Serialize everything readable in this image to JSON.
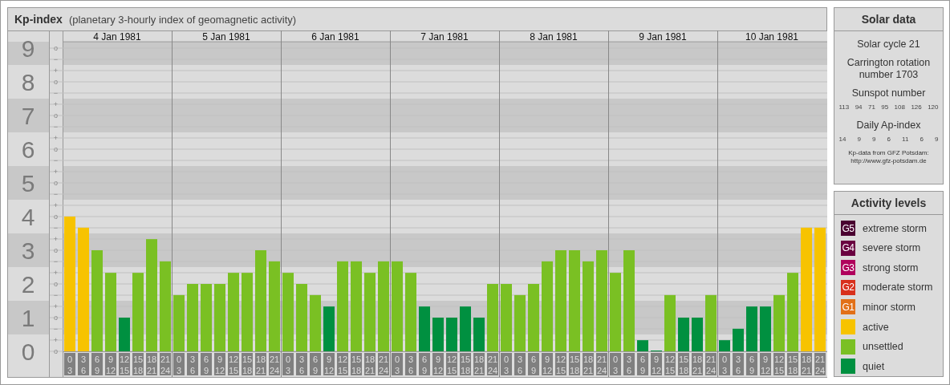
{
  "header": {
    "title": "Kp-index",
    "subtitle": "(planetary 3-hourly index of geomagnetic activity)"
  },
  "kp_chart": {
    "days": [
      "4 Jan 1981",
      "5 Jan 1981",
      "6 Jan 1981",
      "7 Jan 1981",
      "8 Jan 1981",
      "9 Jan 1981",
      "10 Jan 1981"
    ],
    "minor_ticks": [
      "o",
      "−",
      "+",
      "o",
      "−",
      "+",
      "o",
      "−",
      "+",
      "o",
      "−",
      "+",
      "o",
      "−",
      "+",
      "o",
      "−",
      "+",
      "o",
      "−",
      "+",
      "o",
      "−",
      "+",
      "o",
      "−",
      "+",
      "o"
    ],
    "chart_data": {
      "type": "bar",
      "grid": true,
      "ylim": [
        0,
        9.2
      ],
      "yticks": [
        0,
        1,
        2,
        3,
        4,
        5,
        6,
        7,
        8,
        9
      ],
      "categories": [
        "0 3",
        "3 6",
        "6 9",
        "9 12",
        "12 15",
        "15 18",
        "18 21",
        "21 24",
        "0 3",
        "3 6",
        "6 9",
        "9 12",
        "12 15",
        "15 18",
        "18 21",
        "21 24",
        "0 3",
        "3 6",
        "6 9",
        "9 12",
        "12 15",
        "15 18",
        "18 21",
        "21 24",
        "0 3",
        "3 6",
        "6 9",
        "9 12",
        "12 15",
        "15 18",
        "18 21",
        "21 24",
        "0 3",
        "3 6",
        "6 9",
        "9 12",
        "12 15",
        "15 18",
        "18 21",
        "21 24",
        "0 3",
        "3 6",
        "6 9",
        "9 12",
        "12 15",
        "15 18",
        "18 21",
        "21 24",
        "0 3",
        "3 6",
        "6 9",
        "9 12",
        "12 15",
        "15 18",
        "18 21",
        "21 24"
      ],
      "series": [
        {
          "name": "quiet",
          "color": "#009040",
          "values": [
            null,
            null,
            null,
            null,
            1,
            null,
            null,
            null,
            null,
            null,
            null,
            null,
            null,
            null,
            null,
            null,
            null,
            null,
            null,
            1.33,
            null,
            null,
            null,
            null,
            null,
            null,
            1.33,
            1,
            1,
            1.33,
            1,
            null,
            null,
            null,
            null,
            null,
            null,
            null,
            null,
            null,
            null,
            null,
            0.33,
            0,
            null,
            1,
            1,
            null,
            0.33,
            0.67,
            1.33,
            1.33,
            null,
            null,
            null,
            null
          ]
        },
        {
          "name": "unsettled",
          "color": "#7ac023",
          "values": [
            null,
            null,
            3,
            2.33,
            null,
            2.33,
            3.33,
            2.67,
            1.67,
            2,
            2,
            2,
            2.33,
            2.33,
            3,
            2.67,
            2.33,
            2,
            1.67,
            null,
            2.67,
            2.67,
            2.33,
            2.67,
            2.67,
            2.33,
            null,
            null,
            null,
            null,
            null,
            2,
            2,
            1.67,
            2,
            2.67,
            3,
            3,
            2.67,
            3,
            2.33,
            3,
            null,
            null,
            1.67,
            null,
            null,
            1.67,
            null,
            null,
            null,
            null,
            1.67,
            2.33,
            null,
            null
          ]
        },
        {
          "name": "active",
          "color": "#f7c300",
          "values": [
            4,
            3.67,
            null,
            null,
            null,
            null,
            null,
            null,
            null,
            null,
            null,
            null,
            null,
            null,
            null,
            null,
            null,
            null,
            null,
            null,
            null,
            null,
            null,
            null,
            null,
            null,
            null,
            null,
            null,
            null,
            null,
            null,
            null,
            null,
            null,
            null,
            null,
            null,
            null,
            null,
            null,
            null,
            null,
            null,
            null,
            null,
            null,
            null,
            null,
            null,
            null,
            null,
            null,
            null,
            3.67,
            3.67
          ]
        }
      ]
    }
  },
  "solar_data": {
    "title": "Solar data",
    "solar_cycle": "Solar cycle 21",
    "carrington": "Carrington rotation number 1703",
    "sunspot_label": "Sunspot number",
    "sunspot_numbers": [
      "113",
      "94",
      "71",
      "95",
      "108",
      "126",
      "120"
    ],
    "ap_label": "Daily Ap-index",
    "ap_values": [
      "14",
      "9",
      "9",
      "6",
      "11",
      "6",
      "9"
    ],
    "source": "Kp-data from GFZ Potsdam:",
    "source_url": "http://www.gfz-potsdam.de"
  },
  "activity_levels": {
    "title": "Activity levels",
    "items": [
      {
        "badge": "G5",
        "label": "extreme storm",
        "color": "#4a0030"
      },
      {
        "badge": "G4",
        "label": "severe storm",
        "color": "#6a0040"
      },
      {
        "badge": "G3",
        "label": "strong storm",
        "color": "#b0005c"
      },
      {
        "badge": "G2",
        "label": "moderate storm",
        "color": "#d8301c"
      },
      {
        "badge": "G1",
        "label": "minor storm",
        "color": "#e27018"
      }
    ]
  }
}
